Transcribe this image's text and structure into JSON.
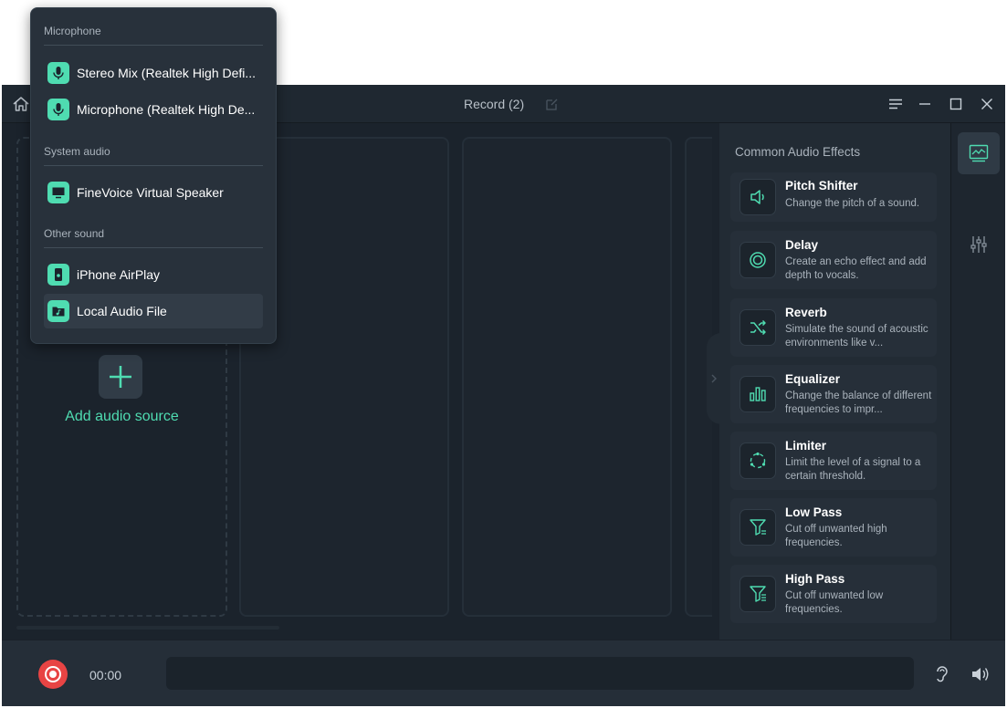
{
  "window": {
    "title": "Record (2)"
  },
  "source": {
    "add_label": "Add audio source"
  },
  "effects": {
    "title": "Common Audio Effects",
    "items": [
      {
        "name": "Pitch Shifter",
        "desc": "Change the pitch of a sound.",
        "icon": "speaker-icon"
      },
      {
        "name": "Delay",
        "desc": "Create an echo effect and add depth to vocals.",
        "icon": "echo-icon"
      },
      {
        "name": "Reverb",
        "desc": "Simulate the sound of acoustic environments like v...",
        "icon": "shuffle-icon"
      },
      {
        "name": "Equalizer",
        "desc": "Change the balance of different frequencies to impr...",
        "icon": "bars-icon"
      },
      {
        "name": "Limiter",
        "desc": "Limit the level of a signal to a certain threshold.",
        "icon": "circle-dots-icon"
      },
      {
        "name": "Low Pass",
        "desc": "Cut off unwanted high frequencies.",
        "icon": "filter-low-icon"
      },
      {
        "name": "High Pass",
        "desc": "Cut off unwanted low frequencies.",
        "icon": "filter-high-icon"
      }
    ]
  },
  "bottom": {
    "time": "00:00"
  },
  "dropdown": {
    "sections": [
      {
        "label": "Microphone",
        "items": [
          "Stereo Mix (Realtek High Defi...",
          "Microphone (Realtek High De..."
        ]
      },
      {
        "label": "System audio",
        "items": [
          "FineVoice Virtual Speaker"
        ]
      },
      {
        "label": "Other sound",
        "items": [
          "iPhone AirPlay",
          "Local Audio File"
        ]
      }
    ],
    "hovered_item": "Local Audio File"
  },
  "colors": {
    "accent": "#4fdcb1",
    "record": "#e84444",
    "background": "#1b232c"
  }
}
